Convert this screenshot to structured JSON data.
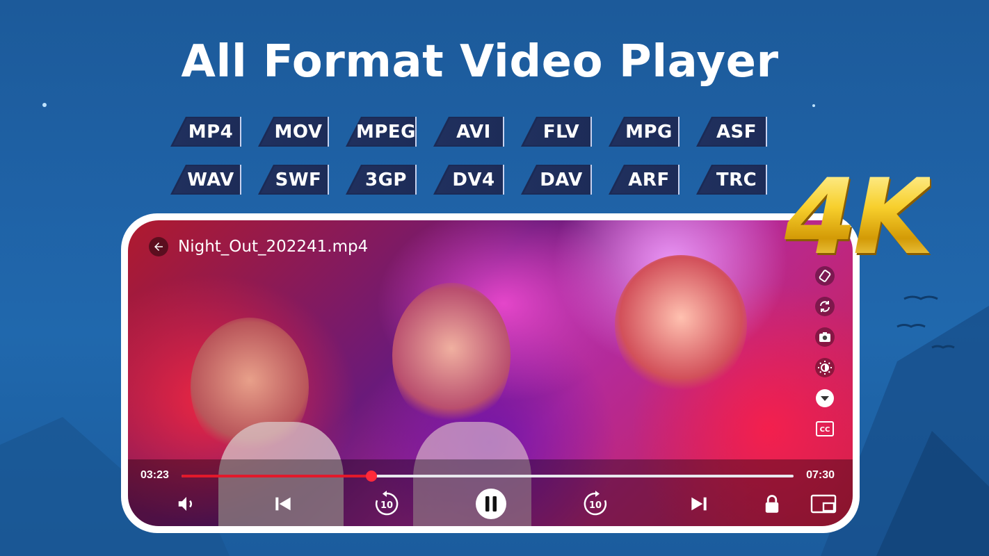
{
  "banner": {
    "title": "All Format Video Player",
    "badge_4k": "4K"
  },
  "formats": {
    "row1": [
      "MP4",
      "MOV",
      "MPEG",
      "AVI",
      "FLV",
      "MPG",
      "ASF"
    ],
    "row2": [
      "WAV",
      "SWF",
      "3GP",
      "DV4",
      "DAV",
      "ARF",
      "TRC"
    ]
  },
  "player": {
    "file_name": "Night_Out_202241.mp4",
    "current_time": "03:23",
    "total_time": "07:30",
    "progress_fraction": 0.31,
    "rewind_seconds": "10",
    "forward_seconds": "10",
    "side_tools": [
      "screen-rotate-icon",
      "refresh-icon",
      "camera-icon",
      "brightness-icon",
      "dropdown-icon",
      "cc-icon"
    ],
    "controls": [
      "volume-icon",
      "skip-previous-icon",
      "rewind-10-icon",
      "pause-icon",
      "forward-10-icon",
      "skip-next-icon",
      "lock-icon",
      "pip-icon"
    ]
  },
  "colors": {
    "background": "#1f62a6",
    "format_tag": "#1b2a55",
    "progress": "#e2192b",
    "badge_gold": "#f5c21a"
  }
}
